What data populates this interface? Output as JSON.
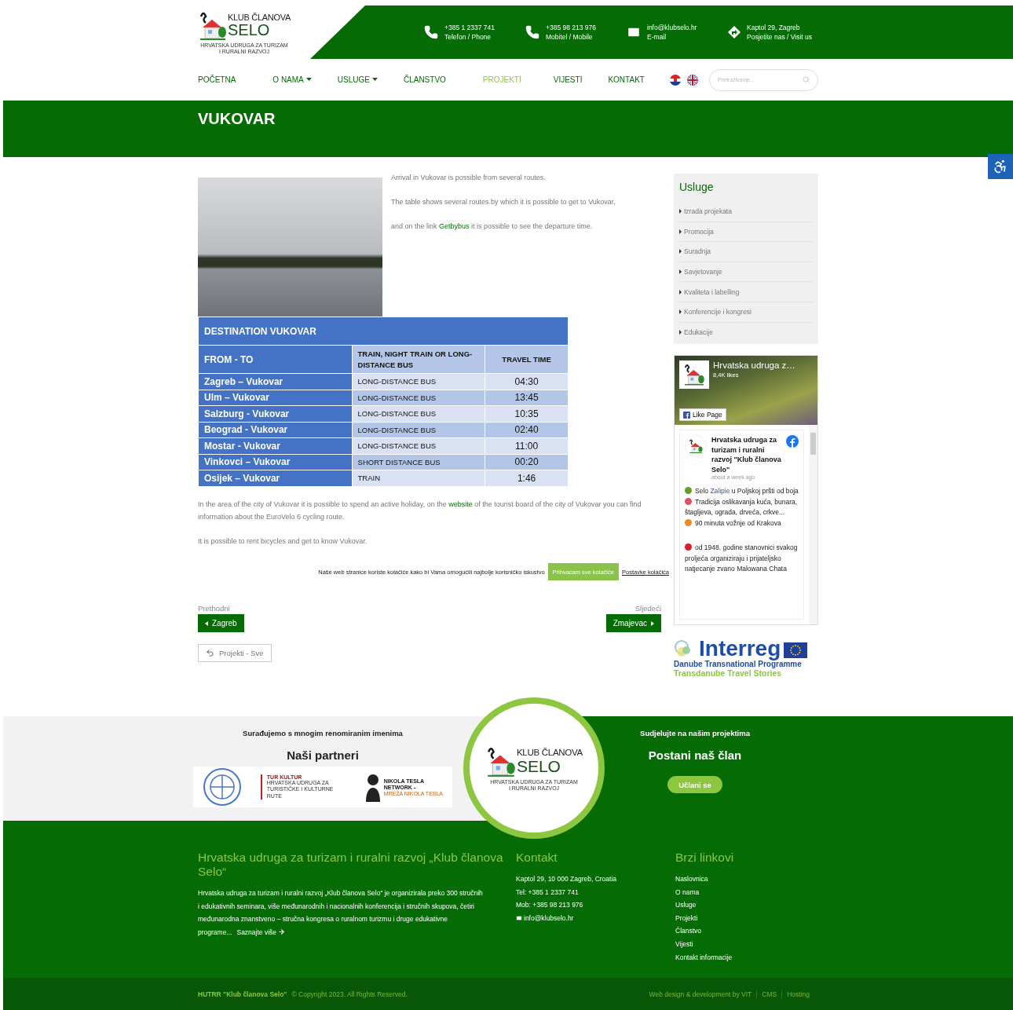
{
  "logo": {
    "line1": "KLUB ČLANOVA",
    "line2": "SELO",
    "tagline": "HRVATSKA UDRUGA ZA TURIZAM I RURALNI RAZVOJ"
  },
  "contacts": [
    {
      "kind": "phone",
      "value": "+385 1 2337 741",
      "label": "Telefon / Phone"
    },
    {
      "kind": "phone",
      "value": "+385 98 213 976",
      "label": "Mobitel / Mobile"
    },
    {
      "kind": "mail",
      "value": "info@klubselo.hr",
      "label": "E-mail"
    },
    {
      "kind": "direction",
      "value": "Kaptol 29, Zagreb",
      "label": "Posjetite nas / Visit us"
    }
  ],
  "nav": [
    {
      "label": "POČETNA",
      "dropdown": false,
      "selected": false
    },
    {
      "label": "O NAMA",
      "dropdown": true,
      "selected": false
    },
    {
      "label": "USLUGE",
      "dropdown": true,
      "selected": false
    },
    {
      "label": "ČLANSTVO",
      "dropdown": false,
      "selected": false
    },
    {
      "label": "PROJEKTI",
      "dropdown": false,
      "selected": true
    },
    {
      "label": "VIJESTI",
      "dropdown": false,
      "selected": false
    },
    {
      "label": "KONTAKT",
      "dropdown": false,
      "selected": false
    }
  ],
  "languages": [
    {
      "kind": "hr"
    },
    {
      "kind": "en"
    }
  ],
  "search": {
    "placeholder": "Pretraživanje..."
  },
  "page_title": "VUKOVAR",
  "intro": [
    "Arrival in Vukovar is possible from several routes.",
    "The table shows several routes by which it is possible to get to Vukovar,",
    "and on the link **Getbybus** it is possible to see the departure time."
  ],
  "table": {
    "title": "DESTINATION  VUKOVAR",
    "columns": [
      "FROM - TO",
      "TRAIN, NIGHT TRAIN OR LONG-DISTANCE BUS",
      "TRAVEL TIME"
    ],
    "rows": [
      [
        "Zagreb – Vukovar",
        "LONG-DISTANCE BUS",
        "04:30"
      ],
      [
        "Ulm – Vukovar",
        "LONG-DISTANCE BUS",
        "13:45"
      ],
      [
        "Salzburg - Vukovar",
        "LONG-DISTANCE BUS",
        "10:35"
      ],
      [
        "Beograd - Vukovar",
        "LONG-DISTANCE BUS",
        "02:40"
      ],
      [
        "Mostar - Vukovar",
        "LONG-DISTANCE BUS",
        "11:00"
      ],
      [
        "Vinkovci – Vukovar",
        "SHORT DISTANCE BUS",
        "00:20"
      ],
      [
        "Osijek – Vukovar",
        "TRAIN",
        "1:46"
      ]
    ]
  },
  "body": [
    {
      "before": "In the area of the city of Vukovar it is possible to spend an active holiday, on the ",
      "link": "website",
      "after": " of the tourist board of the city of Vukovar you can find information about the EuroVelo 6 cycling route."
    },
    {
      "before": "It is possible to rent bicycles and get to know Vukovar."
    }
  ],
  "cookie": {
    "text": "Naše web stranice koriste kolačiće kako bi Vama omogućili najbolje korisničko iskustvo",
    "accept": "Prihvaćam sve kolačiće",
    "settings": "Postavke kolačića"
  },
  "pager": {
    "prev_label": "Prethodni",
    "prev": "Zagreb",
    "next_label": "Sljedeći",
    "next": "Zmajevac",
    "all": "Projekti - Sve"
  },
  "sidebar": {
    "title": "Usluge",
    "items": [
      "Izrada projekata",
      "Promocija",
      "Suradnja",
      "Savjetovanje",
      "Kvaliteta i labelling",
      "Konferencije i kongresi",
      "Edukacije"
    ]
  },
  "facebook": {
    "page_name": "Hrvatska udruga z…",
    "likes": "8,4K likes",
    "like_button": "Like Page",
    "post_author": "Hrvatska udruga za turizam i ruralni razvoj \"Klub članova Selo\"",
    "post_time": "about a week ago",
    "post_lines": [
      {
        "color": "#6a9a2a",
        "before": "Selo ",
        "link": "Zalipie",
        "after": " u Poljskoj pršti od boja"
      },
      {
        "color": "#e0506a",
        "before": "Tradicija oslikavanja kuća, bunara, štagljeva, ograda, drveća, crkve..."
      },
      {
        "color": "#f08a24",
        "before": "90 minuta vožnje od Krakova"
      },
      {
        "color": "#d8202a",
        "before": "od 1948. godine stanovnici svakog proljeća organiziraju i prijateljsko natjecanje zvano Malowana Chata"
      }
    ]
  },
  "interreg": {
    "name": "Interreg",
    "programme": "Danube Transnational Programme",
    "project": "Transdanube Travel Stories"
  },
  "partners": {
    "subtitle": "Surađujemo s mnogim renomiranim imenima",
    "title": "Naši partneri",
    "tur_kultur": "TUR KULTUR",
    "tur_kultur_sub": "HRVATSKA UDRUGA ZA TURISTIČKE I KULTURNE RUTE",
    "tesla": "NIKOLA TESLA NETWORK -",
    "tesla_sub": "MREŽA NIKOLA TESLA"
  },
  "circle_logo": {
    "line1": "KLUB ČLANOVA",
    "line2": "SELO",
    "tagline": "HRVATSKA UDRUGA ZA TURIZAM I RURALNI RAZVOJ"
  },
  "join": {
    "subtitle": "Sudjelujte na našim projektima",
    "title": "Postani naš član",
    "button": "Učlani se"
  },
  "footer": {
    "about_title": "Hrvatska udruga za turizam i ruralni razvoj „Klub članova Selo“",
    "about_text": "Hrvatska udruga za turizam i ruralni razvoj „Klub članova Selo“ je organizirala preko 300 stručnih i edukativnih seminara, više međunarodnih i nacionalnih konferencija i stručnih skupova, četiri međunarodna znanstveno – stručna kongresa o ruralnom turizmu i druge edukativne programe...",
    "more": "Saznajte više",
    "contact_title": "Kontakt",
    "contact_lines": [
      "Kaptol 29, 10 000 Zagreb, Croatia",
      "Tel: +385 1 2337 741",
      "Mob: +385 98 213 976"
    ],
    "email": "info@klubselo.hr",
    "links_title": "Brzi linkovi",
    "links": [
      "Naslovnica",
      "O nama",
      "Usluge",
      "Projekti",
      "Članstvo",
      "Vijesti",
      "Kontakt informacije"
    ]
  },
  "bottom": {
    "brand": "HUTRR \"Klub članova Selo\"",
    "copyright": "© Copyright 2023. All Rights Reserved.",
    "links": [
      "Web design & development by VIT",
      "CMS",
      "Hosting"
    ]
  }
}
